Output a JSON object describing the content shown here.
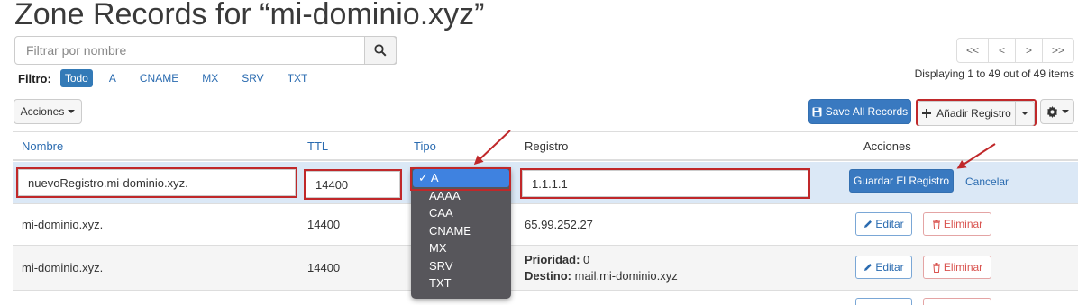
{
  "page": {
    "title": "Zone Records for “mi-dominio.xyz”"
  },
  "search": {
    "placeholder": "Filtrar por nombre",
    "icon": "search-icon"
  },
  "filter": {
    "label": "Filtro:",
    "items": [
      {
        "label": "Todo",
        "active": true
      },
      {
        "label": "A",
        "active": false
      },
      {
        "label": "CNAME",
        "active": false
      },
      {
        "label": "MX",
        "active": false
      },
      {
        "label": "SRV",
        "active": false
      },
      {
        "label": "TXT",
        "active": false
      }
    ]
  },
  "pagination": {
    "buttons": [
      "<<",
      "<",
      ">",
      ">>"
    ],
    "displaying": "Displaying 1 to 49 out of 49 items"
  },
  "toolbar": {
    "acciones_label": "Acciones",
    "save_all_label": "Save All Records",
    "add_label": "Añadir Registro"
  },
  "table": {
    "headers": {
      "nombre": "Nombre",
      "ttl": "TTL",
      "tipo": "Tipo",
      "registro": "Registro",
      "acciones": "Acciones"
    },
    "edit_row": {
      "nombre": "nuevoRegistro.mi-dominio.xyz.",
      "ttl": "14400",
      "registro": "1.1.1.1",
      "save_label": "Guardar El Registro",
      "cancel_label": "Cancelar"
    },
    "rows": [
      {
        "nombre": "mi-dominio.xyz.",
        "ttl": "14400",
        "registro": "65.99.252.27"
      },
      {
        "nombre": "mi-dominio.xyz.",
        "ttl": "14400",
        "prioridad_label": "Prioridad:",
        "prioridad": "0",
        "destino_label": "Destino:",
        "destino": "mail.mi-dominio.xyz"
      }
    ],
    "edit_label": "Editar",
    "delete_label": "Eliminar"
  },
  "type_dropdown": {
    "selected": "A",
    "check": "✓",
    "options": [
      "A",
      "AAAA",
      "CAA",
      "CNAME",
      "MX",
      "SRV",
      "TXT"
    ]
  },
  "colors": {
    "primary": "#337ab7",
    "highlight": "#c0282a",
    "edit_row_bg": "#dbe8f6"
  }
}
